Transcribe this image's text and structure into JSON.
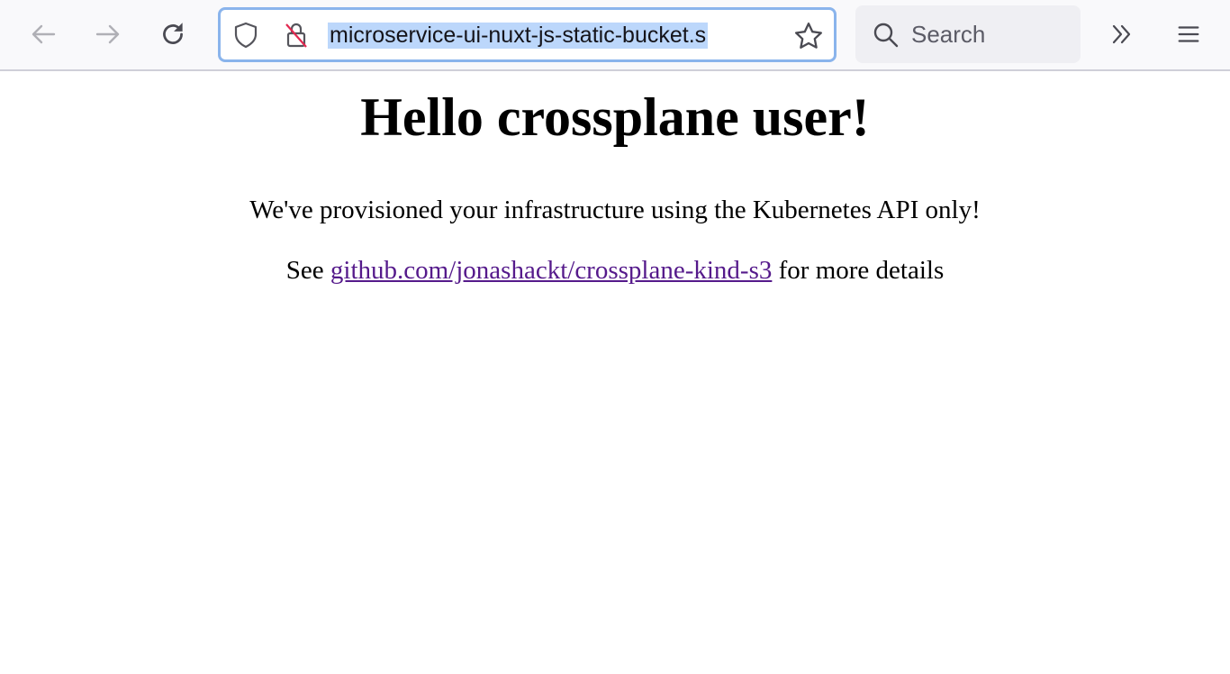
{
  "browser": {
    "url": "microservice-ui-nuxt-js-static-bucket.s",
    "search_placeholder": "Search",
    "icons": [
      "back-arrow-icon",
      "forward-arrow-icon",
      "reload-icon",
      "shield-icon",
      "insecure-lock-icon",
      "star-icon",
      "search-icon",
      "chevron-double-right-icon",
      "hamburger-menu-icon"
    ]
  },
  "page": {
    "heading": "Hello crossplane user!",
    "line1": "We've provisioned your infrastructure using the Kubernetes API only!",
    "line2_prefix": "See ",
    "link_text": "github.com/jonashackt/crossplane-kind-s3",
    "line2_suffix": " for more details",
    "link_color": "#551a8b"
  }
}
